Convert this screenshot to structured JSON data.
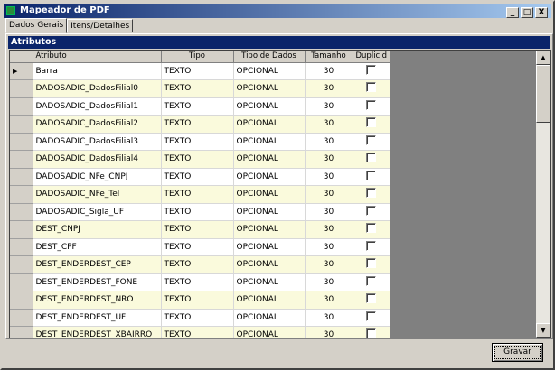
{
  "window": {
    "title": "Mapeador de PDF",
    "minimize": "_",
    "maximize": "□",
    "close": "X"
  },
  "tabs": [
    {
      "label": "Dados Gerais",
      "active": true
    },
    {
      "label": "Itens/Detalhes",
      "active": false
    }
  ],
  "panel": {
    "title": "Atributos"
  },
  "grid": {
    "columns": [
      "Atributo",
      "Tipo",
      "Tipo de Dados",
      "Tamanho",
      "Duplicid"
    ],
    "current_row_marker": "▶",
    "rows": [
      {
        "atributo": "Barra",
        "tipo": "TEXTO",
        "tipo_dados": "OPCIONAL",
        "tamanho": "30",
        "duplicid": false
      },
      {
        "atributo": "DADOSADIC_DadosFilial0",
        "tipo": "TEXTO",
        "tipo_dados": "OPCIONAL",
        "tamanho": "30",
        "duplicid": false
      },
      {
        "atributo": "DADOSADIC_DadosFilial1",
        "tipo": "TEXTO",
        "tipo_dados": "OPCIONAL",
        "tamanho": "30",
        "duplicid": false
      },
      {
        "atributo": "DADOSADIC_DadosFilial2",
        "tipo": "TEXTO",
        "tipo_dados": "OPCIONAL",
        "tamanho": "30",
        "duplicid": false
      },
      {
        "atributo": "DADOSADIC_DadosFilial3",
        "tipo": "TEXTO",
        "tipo_dados": "OPCIONAL",
        "tamanho": "30",
        "duplicid": false
      },
      {
        "atributo": "DADOSADIC_DadosFilial4",
        "tipo": "TEXTO",
        "tipo_dados": "OPCIONAL",
        "tamanho": "30",
        "duplicid": false
      },
      {
        "atributo": "DADOSADIC_NFe_CNPJ",
        "tipo": "TEXTO",
        "tipo_dados": "OPCIONAL",
        "tamanho": "30",
        "duplicid": false
      },
      {
        "atributo": "DADOSADIC_NFe_Tel",
        "tipo": "TEXTO",
        "tipo_dados": "OPCIONAL",
        "tamanho": "30",
        "duplicid": false
      },
      {
        "atributo": "DADOSADIC_Sigla_UF",
        "tipo": "TEXTO",
        "tipo_dados": "OPCIONAL",
        "tamanho": "30",
        "duplicid": false
      },
      {
        "atributo": "DEST_CNPJ",
        "tipo": "TEXTO",
        "tipo_dados": "OPCIONAL",
        "tamanho": "30",
        "duplicid": false
      },
      {
        "atributo": "DEST_CPF",
        "tipo": "TEXTO",
        "tipo_dados": "OPCIONAL",
        "tamanho": "30",
        "duplicid": false
      },
      {
        "atributo": "DEST_ENDERDEST_CEP",
        "tipo": "TEXTO",
        "tipo_dados": "OPCIONAL",
        "tamanho": "30",
        "duplicid": false
      },
      {
        "atributo": "DEST_ENDERDEST_FONE",
        "tipo": "TEXTO",
        "tipo_dados": "OPCIONAL",
        "tamanho": "30",
        "duplicid": false
      },
      {
        "atributo": "DEST_ENDERDEST_NRO",
        "tipo": "TEXTO",
        "tipo_dados": "OPCIONAL",
        "tamanho": "30",
        "duplicid": false
      },
      {
        "atributo": "DEST_ENDERDEST_UF",
        "tipo": "TEXTO",
        "tipo_dados": "OPCIONAL",
        "tamanho": "30",
        "duplicid": false
      },
      {
        "atributo": "DEST_ENDERDEST_XBAIRRO",
        "tipo": "TEXTO",
        "tipo_dados": "OPCIONAL",
        "tamanho": "30",
        "duplicid": false
      }
    ]
  },
  "footer": {
    "save_label": "Gravar"
  }
}
